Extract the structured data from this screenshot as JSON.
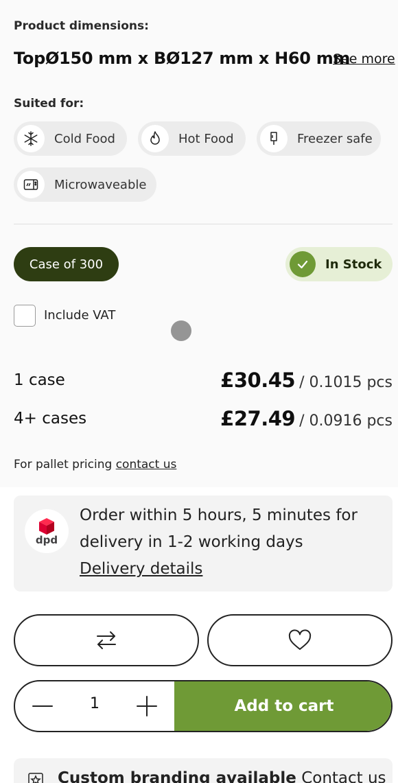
{
  "product_dimensions": {
    "label": "Product dimensions:",
    "value": "TopØ150 mm x BØ127 mm x H60 mm",
    "see_more": "See more"
  },
  "suited_for": {
    "label": "Suited for:",
    "chips": [
      {
        "label": "Cold Food",
        "icon": "snowflake-icon"
      },
      {
        "label": "Hot Food",
        "icon": "flame-icon"
      },
      {
        "label": "Freezer safe",
        "icon": "popsicle-icon"
      },
      {
        "label": "Microwaveable",
        "icon": "microwave-icon"
      }
    ]
  },
  "pack": {
    "case_label": "Case of 300",
    "stock_label": "In Stock"
  },
  "vat": {
    "label": "Include VAT",
    "checked": false
  },
  "pricing": {
    "rows": [
      {
        "qty": "1 case",
        "price": "£30.45",
        "per": "/ 0.1015 pcs"
      },
      {
        "qty": "4+ cases",
        "price": "£27.49",
        "per": "/ 0.0916 pcs"
      }
    ],
    "pallet_text": "For pallet pricing",
    "pallet_link": "contact us"
  },
  "delivery": {
    "logo_text": "dpd",
    "line1": "Order within 5 hours, 5 minutes for",
    "line2": "delivery in 1-2 working days",
    "link": "Delivery details"
  },
  "actions": {
    "compare_icon": "swap-arrows-icon",
    "wishlist_icon": "heart-icon"
  },
  "cart": {
    "quantity": "1",
    "add_label": "Add to cart"
  },
  "branding": {
    "bold_text": "Custom branding available",
    "link_text": "Contact us"
  },
  "colors": {
    "accent_green": "#6f9a36",
    "dark_green": "#2e3d12",
    "stock_bg": "#e6efd6",
    "dpd_red": "#dc0032"
  }
}
